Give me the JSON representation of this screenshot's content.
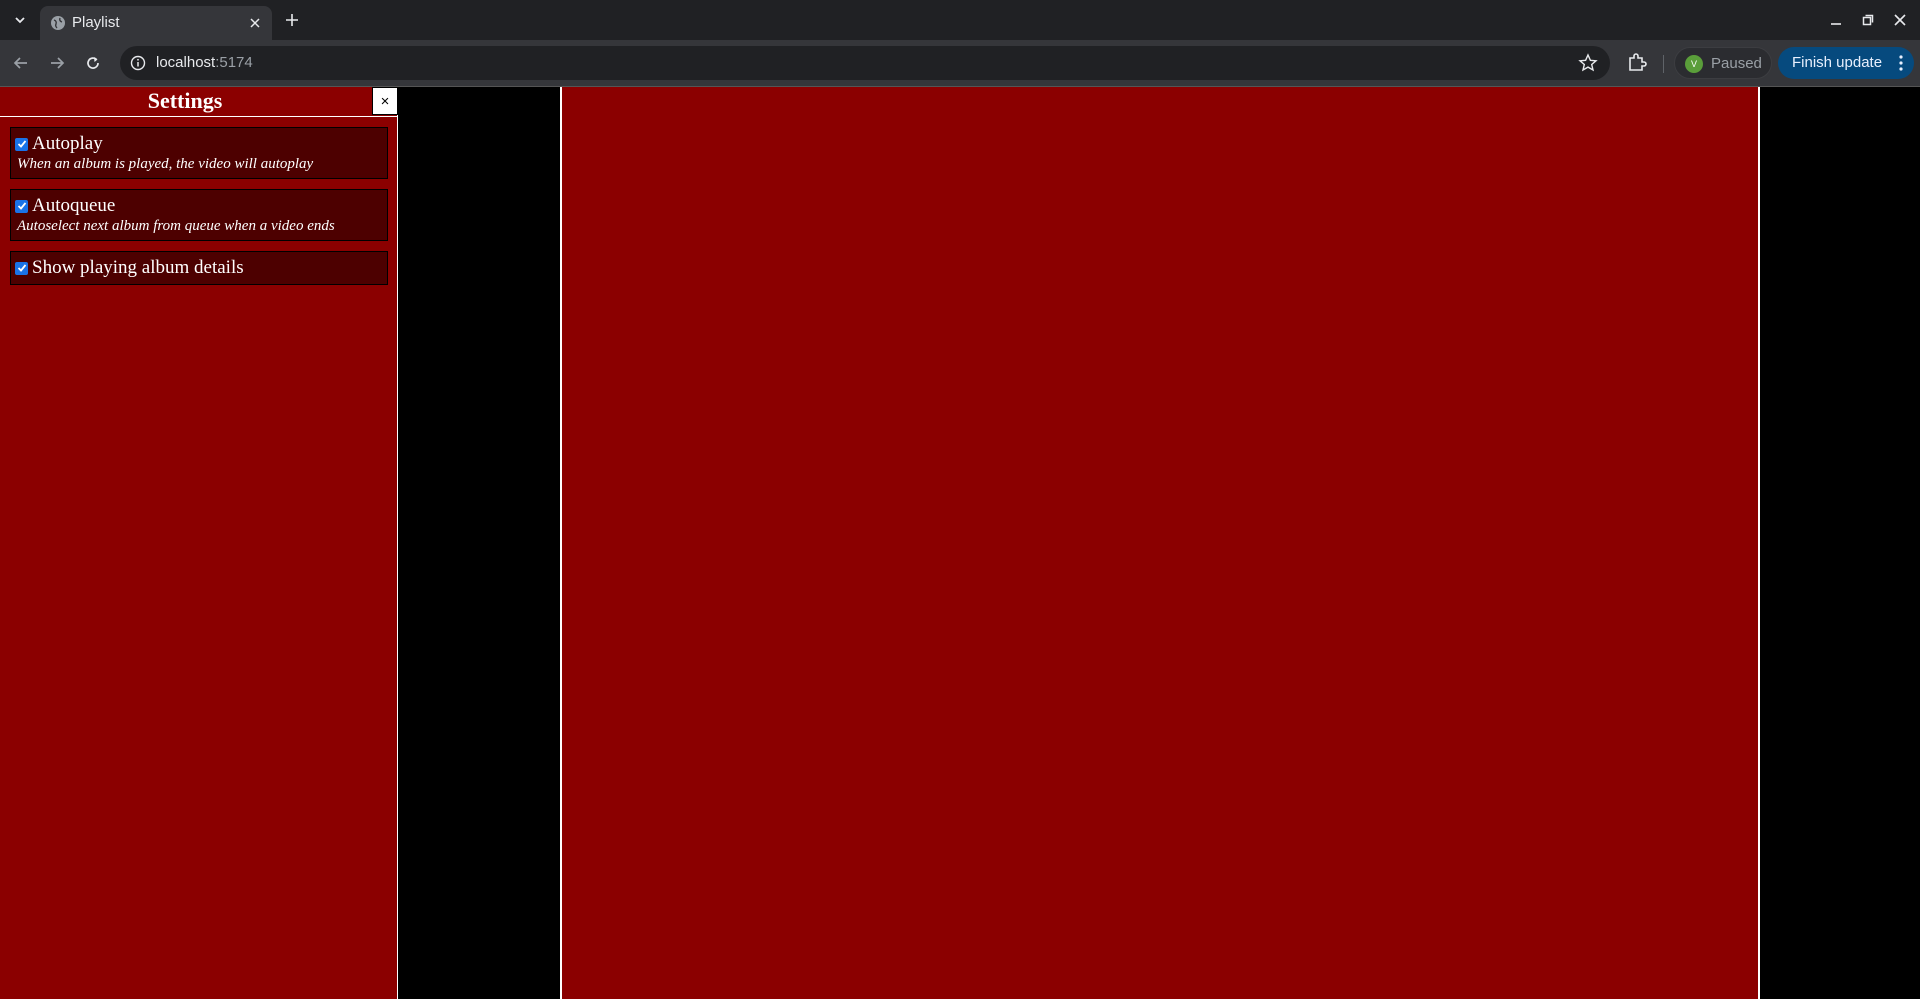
{
  "browser": {
    "tab_title": "Playlist",
    "url_host": "localhost",
    "url_port": ":5174",
    "profile_status": "Paused",
    "profile_initial": "V",
    "update_label": "Finish update"
  },
  "settings": {
    "title": "Settings",
    "close_label": "×",
    "options": [
      {
        "label": "Autoplay",
        "description": "When an album is played, the video will autoplay",
        "checked": true
      },
      {
        "label": "Autoqueue",
        "description": "Autoselect next album from queue when a video ends",
        "checked": true
      },
      {
        "label": "Show playing album details",
        "description": "",
        "checked": true
      }
    ]
  },
  "colors": {
    "panel_bg": "#8b0000",
    "option_bg": "#4d0000",
    "checkbox": "#1a73e8",
    "page_bg": "#000000"
  }
}
